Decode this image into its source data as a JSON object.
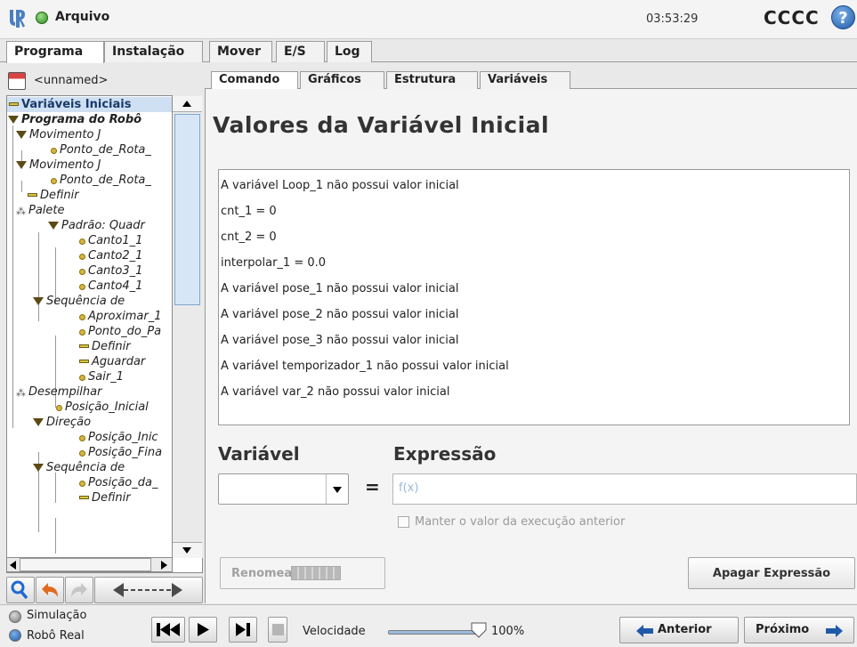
{
  "header": {
    "file_label": "Arquivo",
    "clock": "03:53:29",
    "robot_name": "CCCC",
    "help_label": "?"
  },
  "main_tabs": [
    {
      "label": "Programa",
      "active": true
    },
    {
      "label": "Instalação",
      "active": false
    },
    {
      "label": "Mover",
      "active": false
    },
    {
      "label": "E/S",
      "active": false
    },
    {
      "label": "Log",
      "active": false
    }
  ],
  "program": {
    "name": "<unnamed>"
  },
  "tree": [
    {
      "label": "Variáveis Iniciais",
      "icon": "bar-icon",
      "selected": true
    },
    {
      "label": "Programa do Robô",
      "icon": "triangle-icon"
    },
    {
      "label": "Movimento J",
      "icon": "triangle-icon"
    },
    {
      "label": "Ponto_de_Rota_",
      "icon": "waypoint-icon"
    },
    {
      "label": "Movimento J",
      "icon": "triangle-icon"
    },
    {
      "label": "Ponto_de_Rota_",
      "icon": "waypoint-icon"
    },
    {
      "label": "Definir",
      "icon": "bar-icon"
    },
    {
      "label": "Palete",
      "icon": "pallet-icon"
    },
    {
      "label": "Padrão: Quadr",
      "icon": "triangle-icon"
    },
    {
      "label": "Canto1_1",
      "icon": "waypoint-icon"
    },
    {
      "label": "Canto2_1",
      "icon": "waypoint-icon"
    },
    {
      "label": "Canto3_1",
      "icon": "waypoint-icon"
    },
    {
      "label": "Canto4_1",
      "icon": "waypoint-icon"
    },
    {
      "label": "Sequência de",
      "icon": "triangle-icon"
    },
    {
      "label": "Aproximar_1",
      "icon": "waypoint-icon"
    },
    {
      "label": "Ponto_do_Pa",
      "icon": "waypoint-icon"
    },
    {
      "label": "Definir",
      "icon": "bar-icon"
    },
    {
      "label": "Aguardar",
      "icon": "bar-icon"
    },
    {
      "label": "Sair_1",
      "icon": "waypoint-icon"
    },
    {
      "label": "Desempilhar",
      "icon": "pallet-icon"
    },
    {
      "label": "Posição_Inicial",
      "icon": "waypoint-icon"
    },
    {
      "label": "Direção",
      "icon": "triangle-icon"
    },
    {
      "label": "Posição_Inic",
      "icon": "waypoint-icon"
    },
    {
      "label": "Posição_Fina",
      "icon": "waypoint-icon"
    },
    {
      "label": "Sequência de",
      "icon": "triangle-icon"
    },
    {
      "label": "Posição_da_",
      "icon": "waypoint-icon"
    },
    {
      "label": "Definir",
      "icon": "bar-icon"
    }
  ],
  "sub_tabs": [
    {
      "label": "Comando",
      "active": true
    },
    {
      "label": "Gráficos",
      "active": false
    },
    {
      "label": "Estrutura",
      "active": false
    },
    {
      "label": "Variáveis",
      "active": false
    }
  ],
  "content": {
    "title": "Valores da Variável Inicial",
    "variables": [
      "A variável Loop_1 não possui valor inicial",
      "cnt_1 = 0",
      "cnt_2 = 0",
      "interpolar_1 = 0.0",
      "A variável pose_1 não possui valor inicial",
      "A variável pose_2 não possui valor inicial",
      "A variável pose_3 não possui valor inicial",
      "A variável temporizador_1 não possui valor inicial",
      "A variável var_2 não possui valor inicial"
    ],
    "variable_label": "Variável",
    "expression_label": "Expressão",
    "equals": "=",
    "expression_placeholder": "f(x)",
    "keep_label": "Manter o valor da execução anterior",
    "rename_button": "Renomear",
    "clear_button": "Apagar Expressão"
  },
  "footer": {
    "simulation_label": "Simulação",
    "real_robot_label": "Robô Real",
    "speed_label": "Velocidade",
    "speed_value": "100%",
    "speed_fraction": 1.0,
    "prev_button": "Anterior",
    "next_button": "Próximo"
  },
  "colors": {
    "accent_blue": "#1f5aa8",
    "status_green": "#2e8a1e",
    "selection": "#cfe0f3"
  }
}
